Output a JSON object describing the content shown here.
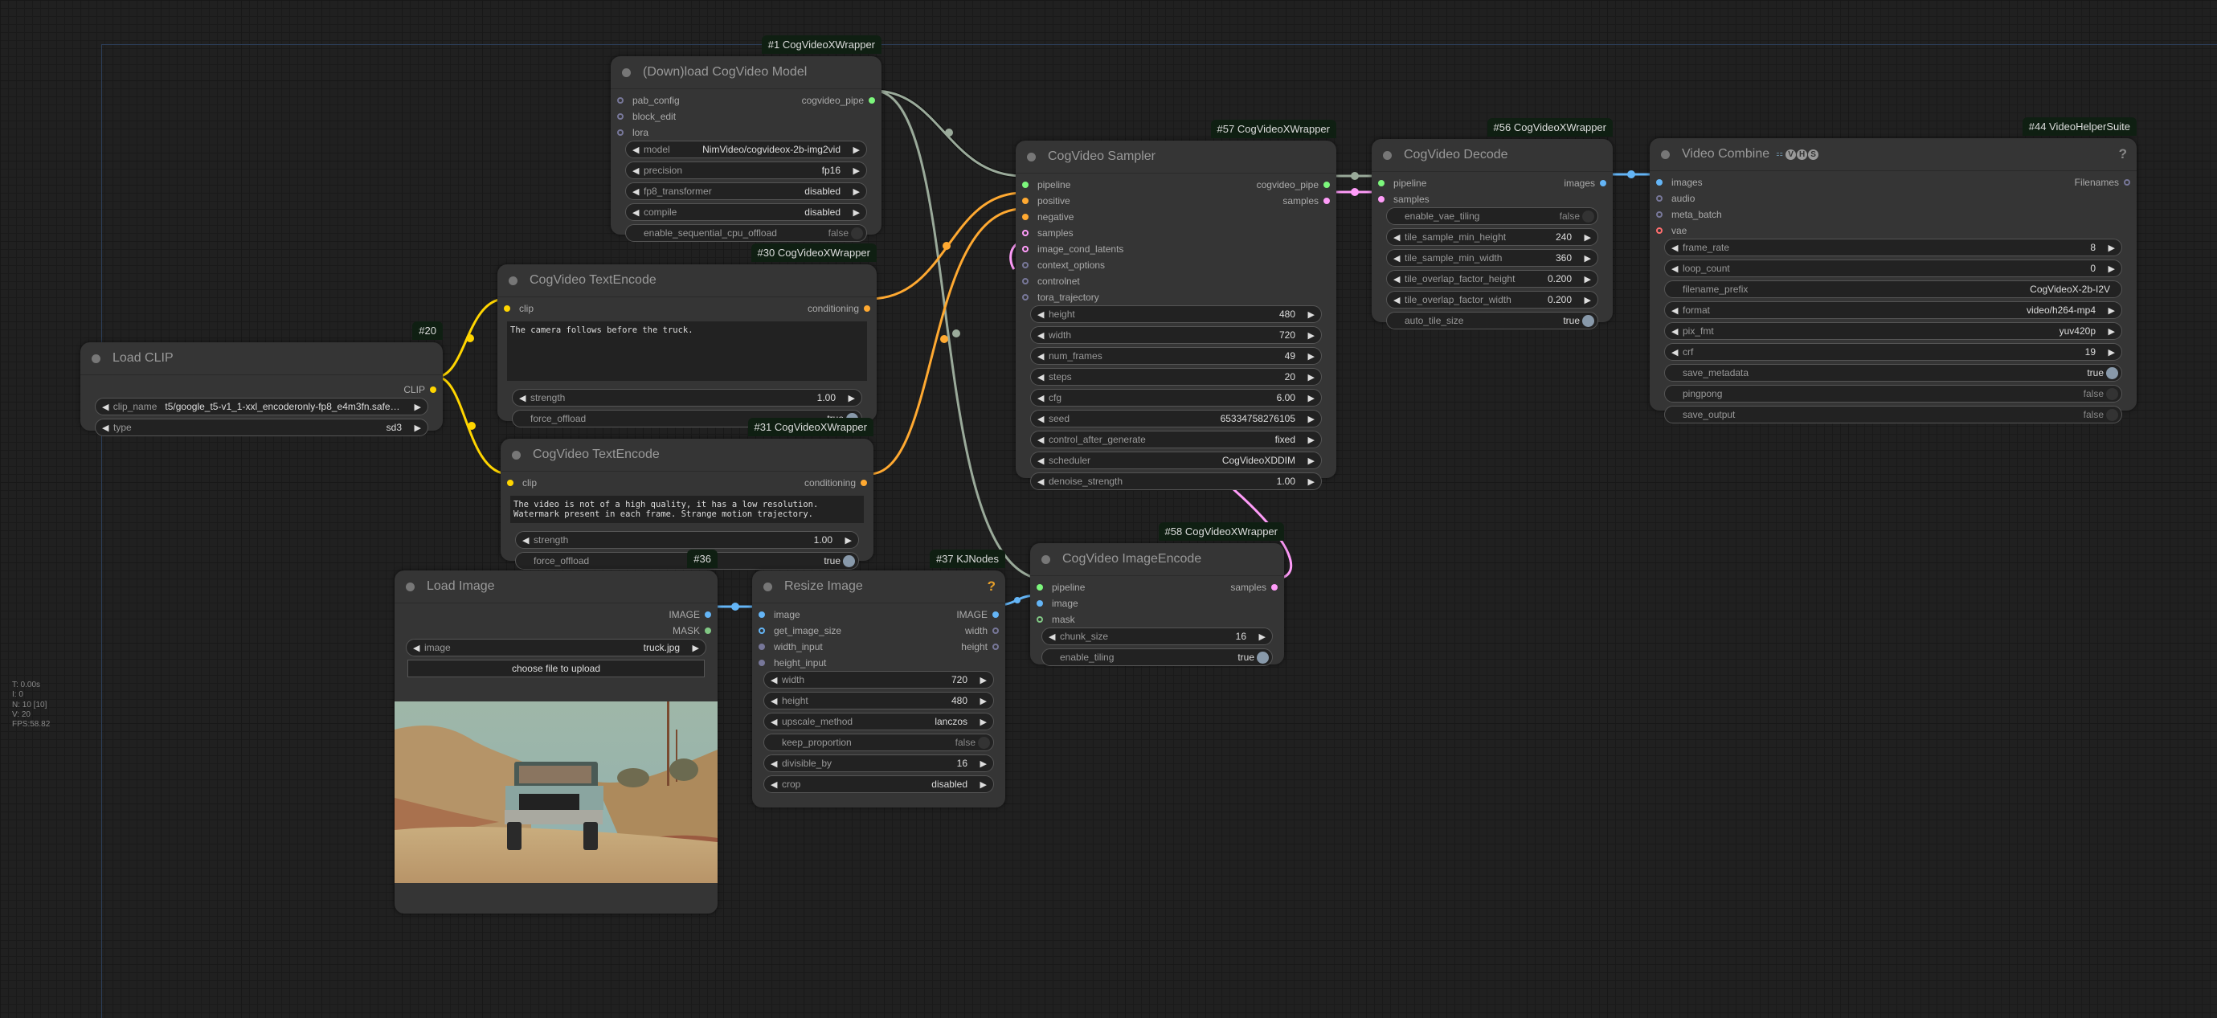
{
  "stats": {
    "t": "T: 0.00s",
    "i": "I: 0",
    "n": "N: 10 [10]",
    "v": "V: 20",
    "fps": "FPS:58.82"
  },
  "colors": {
    "model": "#b0c0b0",
    "clip": "#ffd500",
    "conditioning": "#ffa931",
    "latent": "#ff9cf9",
    "image": "#64b5f6",
    "mask": "#81c784",
    "pipe": "#7cf77c",
    "vae": "#ff6e6e",
    "any": "#777799"
  },
  "nodes": {
    "download_model": {
      "badge": "#1 CogVideoXWrapper",
      "title": "(Down)load CogVideo Model",
      "inputs": [
        "pab_config",
        "block_edit",
        "lora"
      ],
      "outputs": [
        "cogvideo_pipe"
      ],
      "widgets": [
        {
          "name": "model",
          "value": "NimVideo/cogvideox-2b-img2vid"
        },
        {
          "name": "precision",
          "value": "fp16"
        },
        {
          "name": "fp8_transformer",
          "value": "disabled"
        },
        {
          "name": "compile",
          "value": "disabled"
        },
        {
          "name": "enable_sequential_cpu_offload",
          "value": "false"
        }
      ]
    },
    "load_clip": {
      "badge": "#20",
      "title": "Load CLIP",
      "outputs": [
        "CLIP"
      ],
      "widgets": [
        {
          "name": "clip_name",
          "value": "t5/google_t5-v1_1-xxl_encoderonly-fp8_e4m3fn.safete…"
        },
        {
          "name": "type",
          "value": "sd3"
        }
      ]
    },
    "text_encode_pos": {
      "badge": "#30 CogVideoXWrapper",
      "title": "CogVideo TextEncode",
      "inputs": [
        "clip"
      ],
      "outputs": [
        "conditioning"
      ],
      "prompt": "The camera follows before the truck.",
      "widgets": [
        {
          "name": "strength",
          "value": "1.00"
        },
        {
          "name": "force_offload",
          "value": "true"
        }
      ]
    },
    "text_encode_neg": {
      "badge": "#31 CogVideoXWrapper",
      "title": "CogVideo TextEncode",
      "inputs": [
        "clip"
      ],
      "outputs": [
        "conditioning"
      ],
      "prompt": "The video is not of a high quality, it has a low resolution. Watermark present in each frame. Strange motion trajectory.",
      "widgets": [
        {
          "name": "strength",
          "value": "1.00"
        },
        {
          "name": "force_offload",
          "value": "true"
        }
      ]
    },
    "sampler": {
      "badge": "#57 CogVideoXWrapper",
      "title": "CogVideo Sampler",
      "inputs": [
        "pipeline",
        "positive",
        "negative",
        "samples",
        "image_cond_latents",
        "context_options",
        "controlnet",
        "tora_trajectory"
      ],
      "outputs": [
        "cogvideo_pipe",
        "samples"
      ],
      "widgets": [
        {
          "name": "height",
          "value": "480"
        },
        {
          "name": "width",
          "value": "720"
        },
        {
          "name": "num_frames",
          "value": "49"
        },
        {
          "name": "steps",
          "value": "20"
        },
        {
          "name": "cfg",
          "value": "6.00"
        },
        {
          "name": "seed",
          "value": "65334758276105"
        },
        {
          "name": "control_after_generate",
          "value": "fixed"
        },
        {
          "name": "scheduler",
          "value": "CogVideoXDDIM"
        },
        {
          "name": "denoise_strength",
          "value": "1.00"
        }
      ]
    },
    "decode": {
      "badge": "#56 CogVideoXWrapper",
      "title": "CogVideo Decode",
      "inputs": [
        "pipeline",
        "samples"
      ],
      "outputs": [
        "images"
      ],
      "widgets": [
        {
          "name": "enable_vae_tiling",
          "value": "false"
        },
        {
          "name": "tile_sample_min_height",
          "value": "240"
        },
        {
          "name": "tile_sample_min_width",
          "value": "360"
        },
        {
          "name": "tile_overlap_factor_height",
          "value": "0.200"
        },
        {
          "name": "tile_overlap_factor_width",
          "value": "0.200"
        },
        {
          "name": "auto_tile_size",
          "value": "true"
        }
      ]
    },
    "video_combine": {
      "badge": "#44 VideoHelperSuite",
      "title": "Video Combine",
      "title_suffix": "VHS",
      "help": "?",
      "inputs": [
        "images",
        "audio",
        "meta_batch",
        "vae"
      ],
      "outputs": [
        "Filenames"
      ],
      "widgets": [
        {
          "name": "frame_rate",
          "value": "8"
        },
        {
          "name": "loop_count",
          "value": "0"
        },
        {
          "name": "filename_prefix",
          "value": "CogVideoX-2b-I2V"
        },
        {
          "name": "format",
          "value": "video/h264-mp4"
        },
        {
          "name": "pix_fmt",
          "value": "yuv420p"
        },
        {
          "name": "crf",
          "value": "19"
        },
        {
          "name": "save_metadata",
          "value": "true"
        },
        {
          "name": "pingpong",
          "value": "false"
        },
        {
          "name": "save_output",
          "value": "false"
        }
      ]
    },
    "load_image": {
      "badge": "#36",
      "title": "Load Image",
      "outputs": [
        "IMAGE",
        "MASK"
      ],
      "widgets": [
        {
          "name": "image",
          "value": "truck.jpg"
        }
      ],
      "upload_label": "choose file to upload"
    },
    "resize_image": {
      "badge": "#37 KJNodes",
      "title": "Resize Image",
      "help": "?",
      "inputs": [
        "image",
        "get_image_size",
        "width_input",
        "height_input"
      ],
      "outputs": [
        "IMAGE",
        "width",
        "height"
      ],
      "widgets": [
        {
          "name": "width",
          "value": "720"
        },
        {
          "name": "height",
          "value": "480"
        },
        {
          "name": "upscale_method",
          "value": "lanczos"
        },
        {
          "name": "keep_proportion",
          "value": "false"
        },
        {
          "name": "divisible_by",
          "value": "16"
        },
        {
          "name": "crop",
          "value": "disabled"
        }
      ]
    },
    "image_encode": {
      "badge": "#58 CogVideoXWrapper",
      "title": "CogVideo ImageEncode",
      "inputs": [
        "pipeline",
        "image",
        "mask"
      ],
      "outputs": [
        "samples"
      ],
      "widgets": [
        {
          "name": "chunk_size",
          "value": "16"
        },
        {
          "name": "enable_tiling",
          "value": "true"
        }
      ]
    }
  }
}
